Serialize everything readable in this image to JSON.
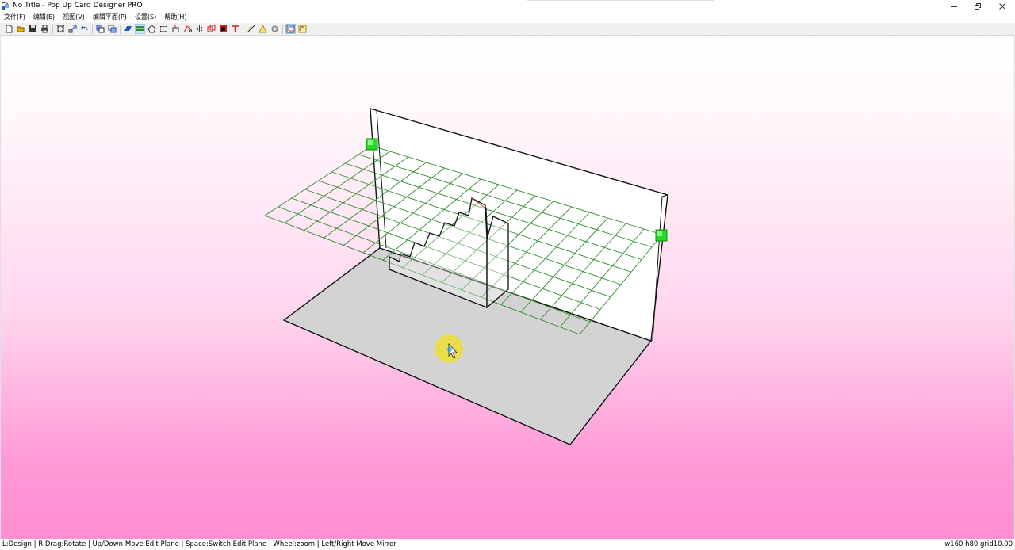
{
  "window": {
    "title": "No Title - Pop Up Card Designer PRO",
    "controls": [
      "minimize",
      "restore",
      "close"
    ]
  },
  "menu": {
    "items": [
      {
        "label": "文件(F)"
      },
      {
        "label": "编辑(E)"
      },
      {
        "label": "视图(V)"
      },
      {
        "label": "编辑平面(P)"
      },
      {
        "label": "设置(S)"
      },
      {
        "label": "帮助(H)"
      }
    ]
  },
  "toolbar": {
    "buttons": [
      {
        "icon": "new-icon"
      },
      {
        "icon": "open-icon"
      },
      {
        "icon": "save-icon"
      },
      {
        "icon": "print-icon"
      },
      {
        "icon": "fit-view-icon"
      },
      {
        "icon": "resize-icon"
      },
      {
        "icon": "undo-icon"
      },
      {
        "icon": "copy-part-icon"
      },
      {
        "icon": "paste-part-icon"
      },
      {
        "icon": "plane-vertical-icon"
      },
      {
        "icon": "plane-horizontal-icon"
      },
      {
        "icon": "polygon-icon"
      },
      {
        "icon": "rectangle-icon"
      },
      {
        "icon": "arch-icon"
      },
      {
        "icon": "cut-icon"
      },
      {
        "icon": "mirror-icon"
      },
      {
        "icon": "duplicate-icon"
      },
      {
        "icon": "fill-icon"
      },
      {
        "icon": "text-icon"
      },
      {
        "icon": "fold-line-icon"
      },
      {
        "icon": "mountain-fold-icon"
      },
      {
        "icon": "settings-icon"
      },
      {
        "icon": "view-3d-icon"
      },
      {
        "icon": "view-2d-icon"
      }
    ],
    "colors": {
      "blue": "#2255cc",
      "red": "#cc2222",
      "green": "#1a8f1a",
      "yellow": "#e6b800"
    }
  },
  "viewport": {
    "background_top": "#ffffff",
    "background_bottom": "#ff8fd2",
    "grid_color": "#2e8b2e",
    "handle_color": "#22dd22",
    "base_color": "#d3d3d3",
    "cursor_highlight": "#f0e020"
  },
  "status": {
    "hint": "L:Design | R-Drag:Rotate | Up/Down:Move Edit Plane | Space:Switch Edit Plane | Wheel:zoom | Left/Right Move Mirror",
    "dims": "w160 h80 grid10.00"
  }
}
